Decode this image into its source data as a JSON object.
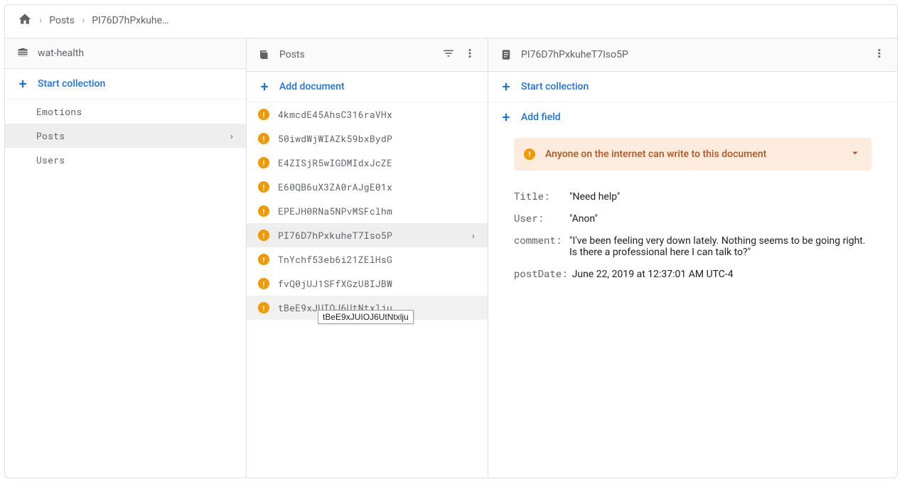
{
  "breadcrumb": {
    "items": [
      "Posts",
      "PI76D7hPxkuhe…"
    ]
  },
  "pane1": {
    "title": "wat-health",
    "start_collection": "Start collection",
    "items": [
      {
        "label": "Emotions",
        "selected": false
      },
      {
        "label": "Posts",
        "selected": true
      },
      {
        "label": "Users",
        "selected": false
      }
    ]
  },
  "pane2": {
    "title": "Posts",
    "add_document": "Add document",
    "items": [
      {
        "id": "4kmcdE45AhsC316raVHx"
      },
      {
        "id": "50iwdWjWIAZk59bxBydP"
      },
      {
        "id": "E4ZISjR5wIGDMIdxJcZE"
      },
      {
        "id": "E60QB6uX3ZA0rAJgE01x"
      },
      {
        "id": "EPEJH0RNa5NPvMSFclhm"
      },
      {
        "id": "PI76D7hPxkuheT7Iso5P",
        "selected": true
      },
      {
        "id": "TnYchf53eb6i21ZElHsG"
      },
      {
        "id": "fvQ0jUJ1SFfXGzU8IJBW"
      },
      {
        "id": "tBeE9xJUIOJ6UtNtxlju",
        "hover": true
      }
    ],
    "tooltip": "tBeE9xJUIOJ6UtNtxlju"
  },
  "pane3": {
    "title": "PI76D7hPxkuheT7Iso5P",
    "start_collection": "Start collection",
    "add_field": "Add field",
    "alert": "Anyone on the internet can write to this document",
    "fields": [
      {
        "key": "Title",
        "value": "Need help",
        "type": "string"
      },
      {
        "key": "User",
        "value": "Anon",
        "type": "string"
      },
      {
        "key": "comment",
        "value": "I've been feeling very down lately. Nothing seems to be going right. Is there a professional here I can talk to?",
        "type": "string"
      },
      {
        "key": "postDate",
        "value": "June 22, 2019 at 12:37:01 AM UTC-4",
        "type": "plain"
      }
    ]
  }
}
